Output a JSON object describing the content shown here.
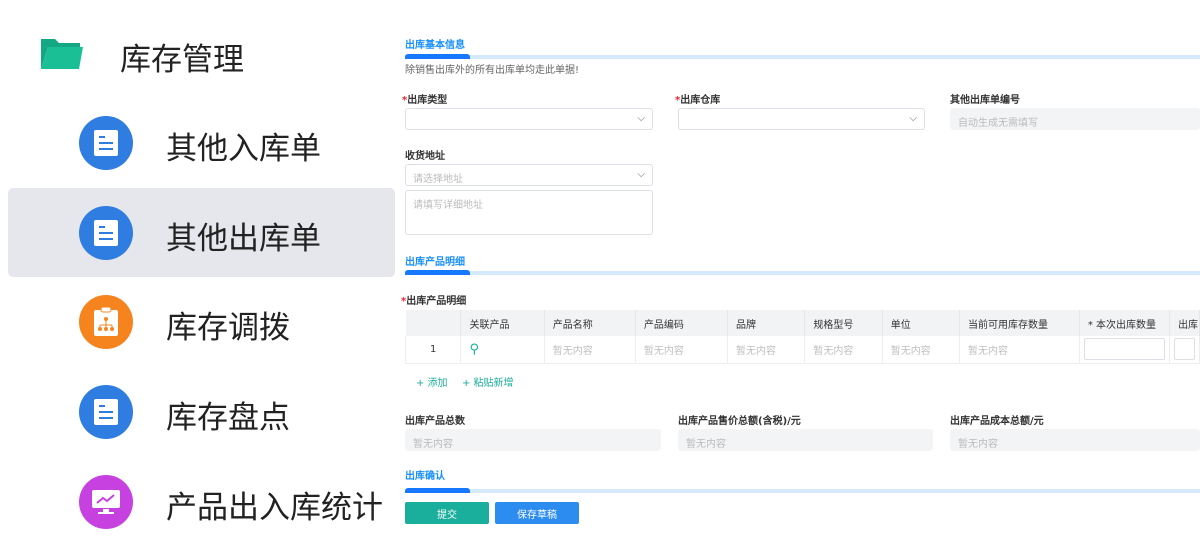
{
  "sidebar": {
    "title": "库存管理",
    "items": [
      {
        "label": "其他入库单",
        "color": "#2f7de1"
      },
      {
        "label": "其他出库单",
        "color": "#2f7de1",
        "selected": true
      },
      {
        "label": "库存调拨",
        "color": "#f5841f"
      },
      {
        "label": "库存盘点",
        "color": "#2f7de1"
      },
      {
        "label": "产品出入库统计",
        "color": "#c641e0"
      }
    ]
  },
  "basic": {
    "title": "出库基本信息",
    "note": "除销售出库外的所有出库单均走此单据!",
    "type_label": "出库类型",
    "warehouse_label": "出库仓库",
    "number_label": "其他出库单编号",
    "number_placeholder": "自动生成无需填写",
    "address_label": "收货地址",
    "address_placeholder": "请选择地址",
    "detail_placeholder": "请填写详细地址",
    "req": "*"
  },
  "products": {
    "title": "出库产品明细",
    "label": "出库产品明细",
    "columns": [
      "",
      "关联产品",
      "产品名称",
      "产品编码",
      "品牌",
      "规格型号",
      "单位",
      "当前可用库存数量",
      "* 本次出库数量",
      "出库"
    ],
    "row": {
      "index": "1",
      "empty": "暂无内容"
    },
    "add": "+ 添加",
    "paste": "+ 粘贴新增"
  },
  "summary": {
    "total_label": "出库产品总数",
    "price_label": "出库产品售价总额(含税)/元",
    "cost_label": "出库产品成本总额/元",
    "empty": "暂无内容"
  },
  "confirm": {
    "title": "出库确认"
  },
  "buttons": {
    "submit": "提交",
    "draft": "保存草稿"
  }
}
